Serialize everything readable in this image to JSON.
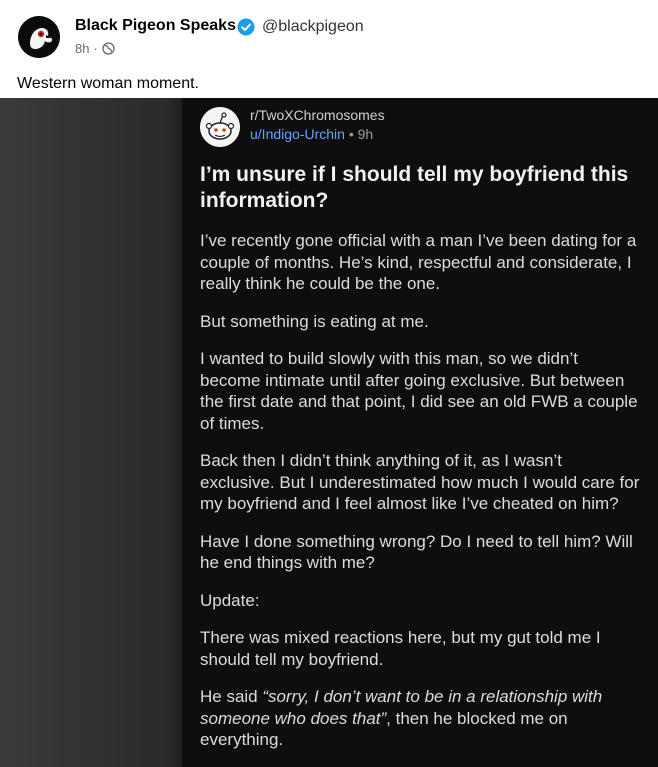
{
  "post": {
    "author": "Black Pigeon Speaks",
    "handle": "@blackpigeon",
    "time": "8h",
    "dot": "·",
    "caption": "Western woman moment."
  },
  "reddit": {
    "subreddit": "r/TwoXChromosomes",
    "user": "u/Indigo-Urchin",
    "dot": "•",
    "time": "9h",
    "title": "I’m unsure if I should tell my boyfriend this information?",
    "paragraphs": [
      "I’ve recently gone official with a man I’ve been dating for a couple of months. He’s kind, respectful and considerate, I really think he could be the one.",
      "But something is eating at me.",
      "I wanted to build slowly with this man, so we didn’t become intimate until after going exclusive. But between the first date and that point, I did see an old FWB a couple of times.",
      "Back then I didn’t think anything of it, as I wasn’t exclusive. But I underestimated how much I would care for my boyfriend and I feel almost like I’ve cheated on him?",
      "Have I done something wrong? Do I need to tell him? Will he end things with me?",
      "Update:",
      "There was mixed reactions here, but my gut told me I should tell my boyfriend."
    ],
    "last_prefix": "He said ",
    "last_quote": "“sorry, I don’t want to be in a relationship with someone who does that”",
    "last_suffix": ", then he blocked me on everything."
  },
  "icons": {
    "verified": "verified-badge-icon",
    "globe": "globe-icon"
  },
  "colors": {
    "verified": "#1d9bf0",
    "username_link": "#6aa0ff"
  }
}
